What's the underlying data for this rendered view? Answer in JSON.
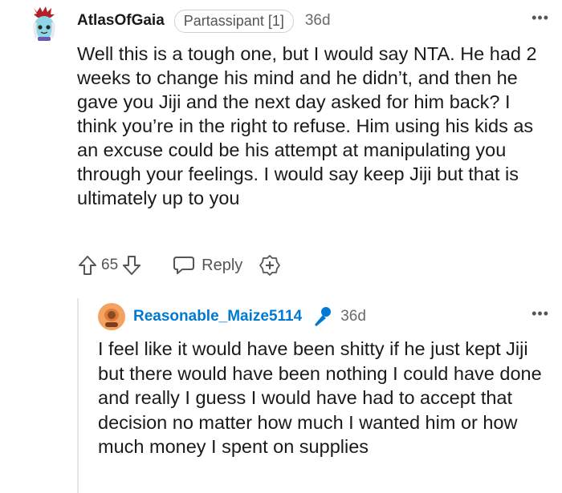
{
  "comment": {
    "author": "AtlasOfGaia",
    "flair": "Partassipant [1]",
    "age": "36d",
    "more": "•••",
    "body": "Well this is a tough one, but I would say NTA. He had 2 weeks to change his mind and he didn’t, and then he gave you Jiji and the next day asked for him back? I think you’re in the right to refuse. Him using his kids as an excuse could be his attempt at manipulating you through your feelings. I would say keep Jiji but that is ultimately up to you",
    "votes": "65",
    "reply_label": "Reply"
  },
  "reply": {
    "author": "Reasonable_Maize5114",
    "age": "36d",
    "more": "•••",
    "body": "I feel like it would have been shitty if he just kept Jiji but there would have been nothing I could have done and really I guess I would have had to accept that decision no matter how much I wanted him or how much money I spent on supplies"
  },
  "icons": {
    "upvote": "upvote-arrow-icon",
    "downvote": "downvote-arrow-icon",
    "reply": "speech-bubble-icon",
    "award": "plus-badge-icon",
    "mic": "microphone-icon"
  },
  "colors": {
    "username_link": "#0079d3",
    "text": "#1a1a1b",
    "meta": "#6a6a6a"
  }
}
